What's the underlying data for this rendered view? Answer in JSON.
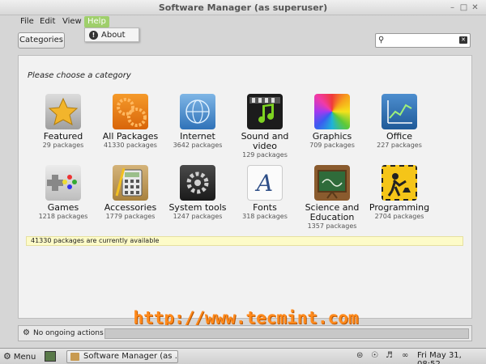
{
  "window": {
    "title": "Software Manager (as superuser)",
    "controls": [
      "minimize",
      "maximize",
      "close"
    ]
  },
  "menubar": {
    "items": [
      "File",
      "Edit",
      "View",
      "Help"
    ],
    "active": "Help",
    "help_menu": {
      "items": [
        {
          "icon": "info-icon",
          "label": "About"
        }
      ]
    }
  },
  "toolbar": {
    "categories_label": "Categories",
    "search": {
      "value": "",
      "placeholder": ""
    }
  },
  "main": {
    "prompt": "Please choose a category",
    "categories": [
      {
        "name": "Featured",
        "count": "29 packages",
        "icon": "star-icon"
      },
      {
        "name": "All Packages",
        "count": "41330 packages",
        "icon": "gears-icon"
      },
      {
        "name": "Internet",
        "count": "3642 packages",
        "icon": "globe-icon"
      },
      {
        "name": "Sound and video",
        "count": "129 packages",
        "icon": "media-icon"
      },
      {
        "name": "Graphics",
        "count": "709 packages",
        "icon": "color-wheel-icon"
      },
      {
        "name": "Office",
        "count": "227 packages",
        "icon": "chart-icon"
      },
      {
        "name": "Games",
        "count": "1218 packages",
        "icon": "gamepad-icon"
      },
      {
        "name": "Accessories",
        "count": "1779 packages",
        "icon": "calculator-icon"
      },
      {
        "name": "System tools",
        "count": "1247 packages",
        "icon": "system-gear-icon"
      },
      {
        "name": "Fonts",
        "count": "318 packages",
        "icon": "font-icon"
      },
      {
        "name": "Science and Education",
        "count": "1357 packages",
        "icon": "chalkboard-icon"
      },
      {
        "name": "Programming",
        "count": "2704 packages",
        "icon": "construction-icon"
      }
    ],
    "availability": "41330 packages are currently available",
    "watermark": "http://www.tecmint.com"
  },
  "statusbar": {
    "text": "No ongoing actions"
  },
  "taskbar": {
    "menu_label": "Menu",
    "task_label": "Software Manager (as ...",
    "clock": "Fri May 31, 08:52"
  }
}
